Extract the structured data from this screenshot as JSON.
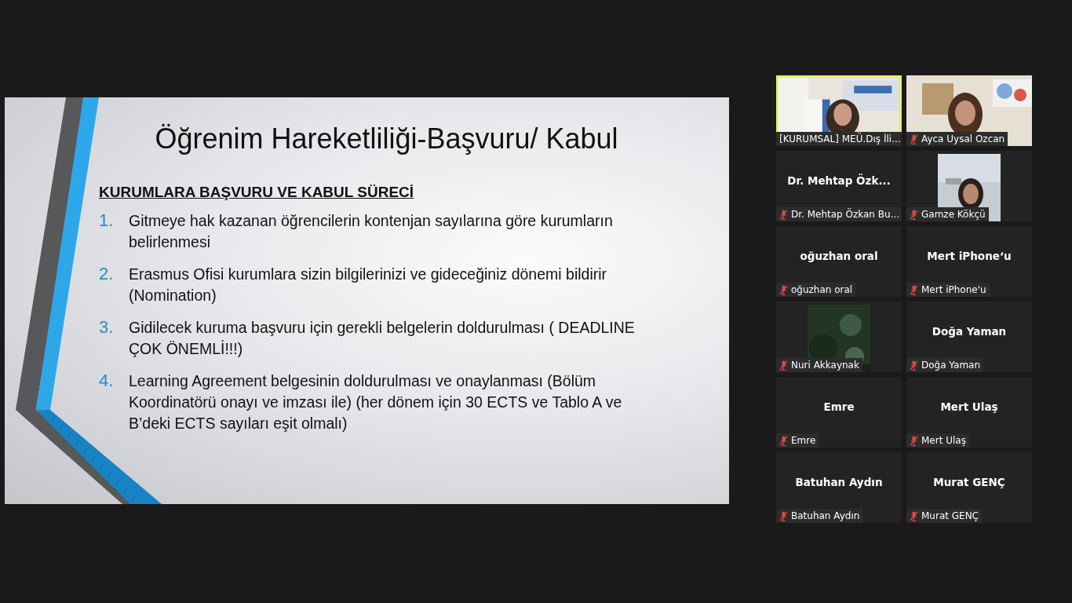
{
  "slide": {
    "title": "Öğrenim Hareketliliği-Başvuru/ Kabul",
    "heading": "KURUMLARA BAŞVURU VE KABUL SÜRECİ",
    "items": [
      {
        "number": "1.",
        "text": "Gitmeye hak kazanan öğrencilerin kontenjan sayılarına göre kurumların belirlenmesi"
      },
      {
        "number": "2.",
        "text": "Erasmus Ofisi kurumlara sizin bilgilerinizi ve gideceğiniz dönemi bildirir (Nomination)"
      },
      {
        "number": "3.",
        "text": "Gidilecek kuruma başvuru için gerekli belgelerin doldurulması ( DEADLINE ÇOK ÖNEMLİ!!!)"
      },
      {
        "number": "4.",
        "text": "Learning Agreement belgesinin doldurulması ve onaylanması (Bölüm Koordinatörü onayı ve imzası ile) (her dönem için 30 ECTS ve Tablo A ve B’deki ECTS sayıları eşit olmalı)"
      }
    ]
  },
  "participants": [
    {
      "kind": "video",
      "label": "[KURUMSAL] MEÜ.Dış İli...",
      "muted": false,
      "speaking": true
    },
    {
      "kind": "video",
      "label": "Ayca Uysal Ozcan",
      "muted": true,
      "speaking": false
    },
    {
      "kind": "name",
      "name": "Dr. Mehtap Özk...",
      "label": "Dr. Mehtap Özkan Bu...",
      "muted": true,
      "speaking": false
    },
    {
      "kind": "video",
      "label": "Gamze Kökçü",
      "muted": true,
      "speaking": false
    },
    {
      "kind": "name",
      "name": "oğuzhan oral",
      "label": "oğuzhan oral",
      "muted": true,
      "speaking": false
    },
    {
      "kind": "name",
      "name": "Mert iPhone‘u",
      "label": "Mert iPhone'u",
      "muted": true,
      "speaking": false
    },
    {
      "kind": "video",
      "label": "Nuri Akkaynak",
      "muted": true,
      "speaking": false
    },
    {
      "kind": "name",
      "name": "Doğa Yaman",
      "label": "Doğa Yaman",
      "muted": true,
      "speaking": false
    },
    {
      "kind": "name",
      "name": "Emre",
      "label": "Emre",
      "muted": true,
      "speaking": false
    },
    {
      "kind": "name",
      "name": "Mert Ulaş",
      "label": "Mert Ulaş",
      "muted": true,
      "speaking": false
    },
    {
      "kind": "name",
      "name": "Batuhan Aydın",
      "label": "Batuhan Aydın",
      "muted": true,
      "speaking": false
    },
    {
      "kind": "name",
      "name": "Murat GENÇ",
      "label": "Murat GENÇ",
      "muted": true,
      "speaking": false
    }
  ]
}
